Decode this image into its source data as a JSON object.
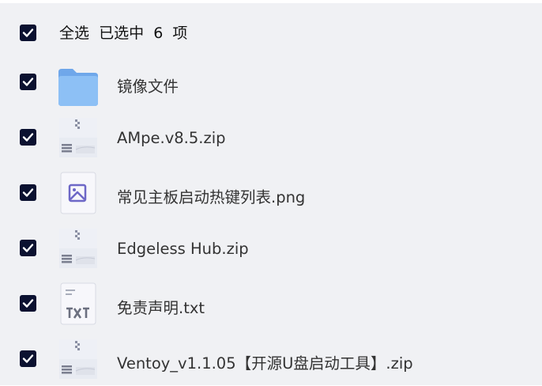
{
  "header": {
    "select_all_label": "全选",
    "selected_prefix": "已选中",
    "selected_count": "6",
    "selected_suffix": "项",
    "checked": true
  },
  "files": [
    {
      "name": "镜像文件",
      "icon": "folder-icon",
      "checked": true
    },
    {
      "name": "AMpe.v8.5.zip",
      "icon": "zip-file-icon",
      "checked": true
    },
    {
      "name": "常见主板启动热键列表.png",
      "icon": "image-file-icon",
      "checked": true
    },
    {
      "name": "Edgeless Hub.zip",
      "icon": "zip-file-icon",
      "checked": true
    },
    {
      "name": "免责声明.txt",
      "icon": "txt-file-icon",
      "checked": true
    },
    {
      "name": "Ventoy_v1.1.05【开源U盘启动工具】.zip",
      "icon": "zip-file-icon",
      "checked": true
    }
  ],
  "colors": {
    "background": "#f0f1f4",
    "checkbox": "#0b1130",
    "folder": "#7fb3f0",
    "image_icon_accent": "#6d67c7"
  }
}
